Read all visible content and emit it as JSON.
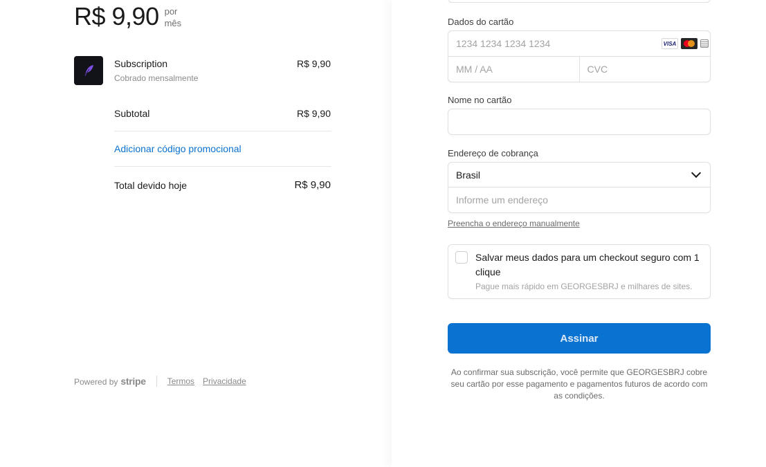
{
  "summary": {
    "price": "R$ 9,90",
    "period_line1": "por",
    "period_line2": "mês",
    "item": {
      "name": "Subscription",
      "billing": "Cobrado mensalmente",
      "price": "R$ 9,90"
    },
    "subtotal_label": "Subtotal",
    "subtotal_value": "R$ 9,90",
    "promo_label": "Adicionar código promocional",
    "total_label": "Total devido hoje",
    "total_value": "R$ 9,90"
  },
  "footer": {
    "powered_by": "Powered by",
    "brand": "stripe",
    "terms": "Termos",
    "privacy": "Privacidade"
  },
  "form": {
    "card_label": "Dados do cartão",
    "card_number_placeholder": "1234 1234 1234 1234",
    "expiry_placeholder": "MM / AA",
    "cvc_placeholder": "CVC",
    "card_brands": [
      "VISA",
      "mastercard",
      "more-cards"
    ],
    "name_label": "Nome no cartão",
    "name_value": "",
    "address_label": "Endereço de cobrança",
    "country_value": "Brasil",
    "address_placeholder": "Informe um endereço",
    "manual_address_link": "Preencha o endereço manualmente",
    "save_title": "Salvar meus dados para um checkout seguro com 1 clique",
    "save_subtitle": "Pague mais rápido em GEORGESBRJ e milhares de sites.",
    "submit_label": "Assinar",
    "legal_text": "Ao confirmar sua subscrição, você permite que GEORGESBRJ cobre seu cartão por esse pagamento e pagamentos futuros de acordo com as condições."
  },
  "colors": {
    "accent": "#0a72d1",
    "product_icon_bg": "#111318",
    "product_icon_fg": "#7b4fe0"
  }
}
